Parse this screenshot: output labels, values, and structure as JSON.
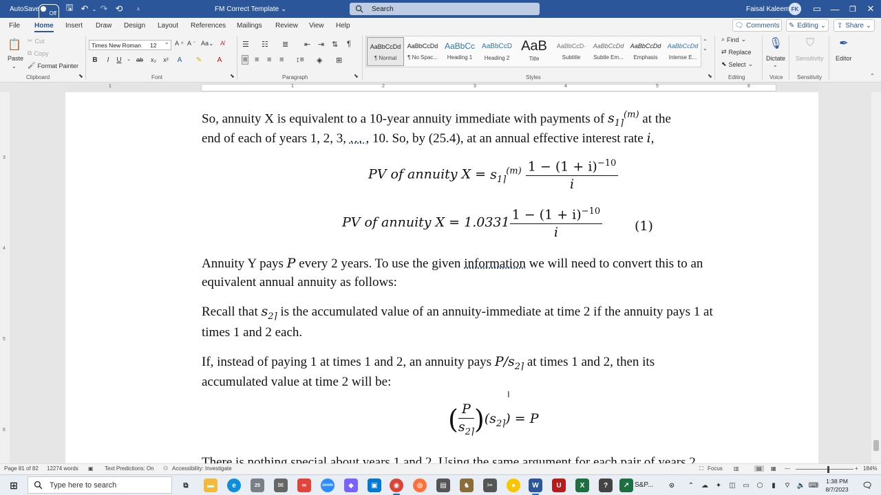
{
  "titlebar": {
    "autosave_label": "AutoSave",
    "autosave_state": "Off",
    "doc_title": "FM Correct Template ⌄",
    "search_placeholder": "Search",
    "user_name": "Faisal Kaleem",
    "user_initials": "FK"
  },
  "tabs": [
    "File",
    "Home",
    "Insert",
    "Draw",
    "Design",
    "Layout",
    "References",
    "Mailings",
    "Review",
    "View",
    "Help"
  ],
  "active_tab": "Home",
  "tab_buttons": {
    "comments": "Comments",
    "editing": "Editing ⌄",
    "share": "Share ⌄"
  },
  "ribbon": {
    "clipboard": {
      "paste": "Paste",
      "cut": "Cut",
      "copy": "Copy",
      "format_painter": "Format Painter",
      "label": "Clipboard"
    },
    "font": {
      "font_name": "Times New Roman",
      "font_size": "12",
      "bold": "B",
      "italic": "I",
      "underline": "U",
      "strike": "ab",
      "sub": "x₂",
      "sup": "x²",
      "label": "Font"
    },
    "paragraph": {
      "label": "Paragraph"
    },
    "styles": {
      "items": [
        {
          "preview": "AaBbCcDd",
          "name": "¶ Normal"
        },
        {
          "preview": "AaBbCcDd",
          "name": "¶ No Spac..."
        },
        {
          "preview": "AaBbCc",
          "name": "Heading 1"
        },
        {
          "preview": "AaBbCcD",
          "name": "Heading 2"
        },
        {
          "preview": "AaB",
          "name": "Title"
        },
        {
          "preview": "AaBbCcD·",
          "name": "Subtitle"
        },
        {
          "preview": "AaBbCcDd",
          "name": "Subtle Em..."
        },
        {
          "preview": "AaBbCcDd",
          "name": "Emphasis"
        },
        {
          "preview": "AaBbCcDd",
          "name": "Intense E..."
        }
      ],
      "label": "Styles"
    },
    "editing": {
      "find": "Find",
      "replace": "Replace",
      "select": "Select",
      "label": "Editing"
    },
    "voice": {
      "dictate": "Dictate",
      "label": "Voice"
    },
    "sensitivity": {
      "button": "Sensitivity",
      "label": "Sensitivity"
    },
    "editor": {
      "button": "Editor"
    }
  },
  "ruler_numbers": [
    "1",
    "1",
    "2",
    "3",
    "4",
    "5",
    "6"
  ],
  "vruler_numbers": [
    "3",
    "4",
    "5",
    "6"
  ],
  "document": {
    "p1_line1_a": "So, annuity X is equivalent to a 10-year annuity immediate with payments of ",
    "p1_line1_b": "at the",
    "p1_line2_a": "end of each of years 1, 2, 3, ",
    "p1_line2_dots": "… ,",
    "p1_line2_b": " 10.  So, by (25.4), at an annual effective interest rate ",
    "eq1_lhs": "PV of annuity X = ",
    "eq1_num": "1 − (1 + i)",
    "eq_den": "i",
    "eq2_lhs": "PV of annuity X = 1.0331",
    "eq2_label": "(1)",
    "p2_line1_a": "Annuity Y pays ",
    "p2_line1_b": " every 2 years. To use the given ",
    "p2_link": "information",
    "p2_line1_c": " we will need to convert this to an",
    "p2_line2": "equivalent annual annuity as follows:",
    "p3_line1_a": "Recall that ",
    "p3_line1_b": " is the accumulated value of an annuity-immediate at time 2 if the annuity pays 1 at",
    "p3_line2": "times 1 and 2 each.",
    "p4_line1_a": "If, instead of paying 1 at times 1 and 2, an annuity pays ",
    "p4_line1_b": " at times 1 and 2, then its",
    "p4_line2": "accumulated value at time 2 will be:",
    "eq3_rhs": " = P",
    "p5_partial": "There is nothing special about years 1 and 2. Using the same argument for each pair of years 2"
  },
  "statusbar": {
    "page": "Page 81 of 82",
    "words": "12274 words",
    "predictions": "Text Predictions: On",
    "accessibility": "Accessibility: Investigate",
    "focus": "Focus",
    "zoom": "184%"
  },
  "taskbar": {
    "search_placeholder": "Type here to search",
    "badge": "25",
    "app_label": "S&P...",
    "time": "1:38 PM",
    "date": "8/7/2023"
  }
}
